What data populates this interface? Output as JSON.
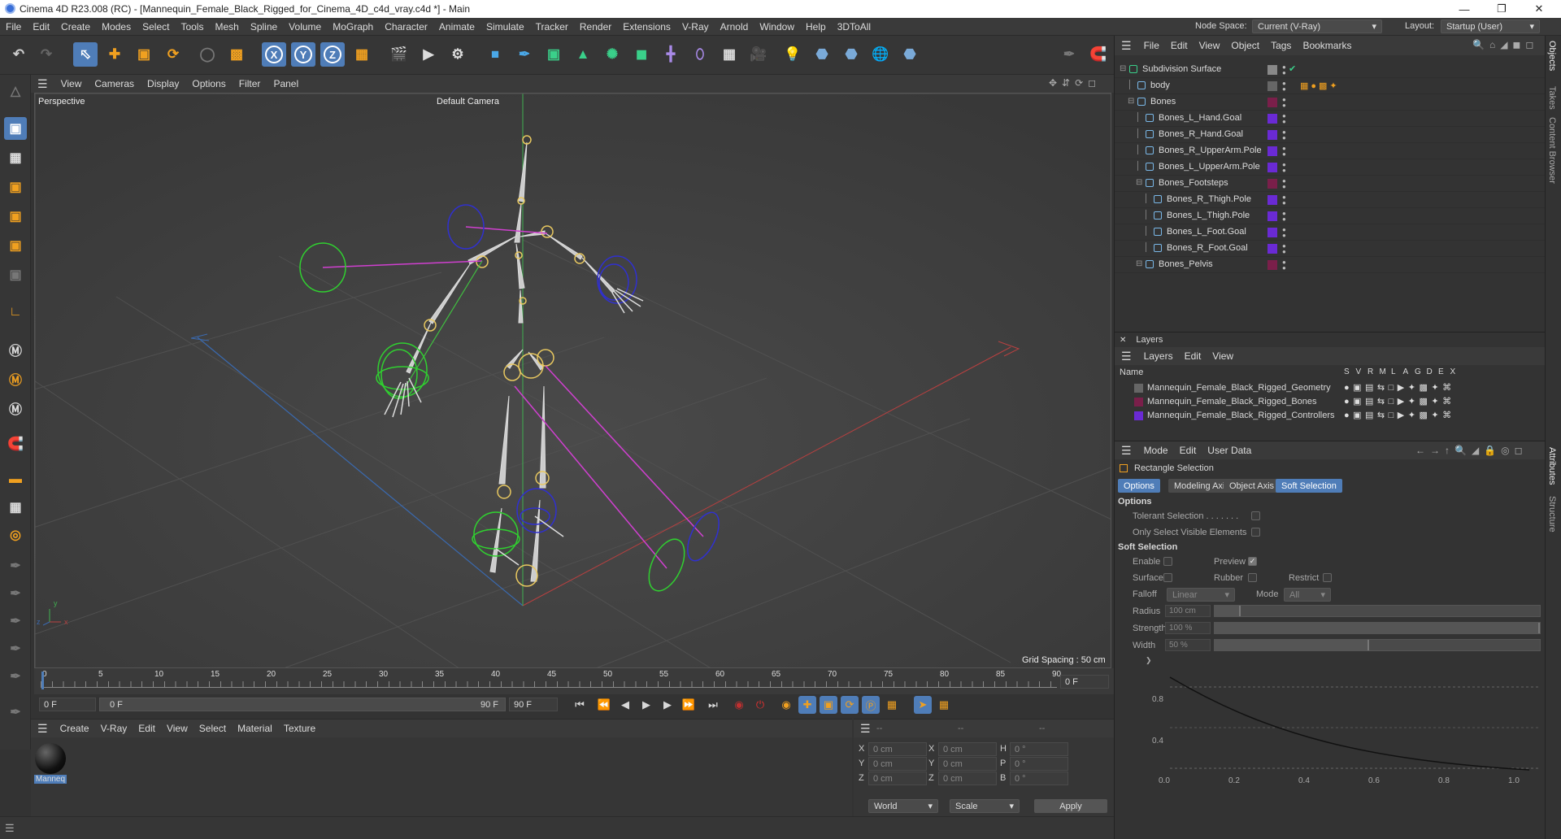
{
  "window": {
    "title": "Cinema 4D R23.008 (RC) - [Mannequin_Female_Black_Rigged_for_Cinema_4D_c4d_vray.c4d *] - Main",
    "minimize": "—",
    "maximize": "❐",
    "close": "✕"
  },
  "menubar": {
    "items": [
      "File",
      "Edit",
      "Create",
      "Modes",
      "Select",
      "Tools",
      "Mesh",
      "Spline",
      "Volume",
      "MoGraph",
      "Character",
      "Animate",
      "Simulate",
      "Tracker",
      "Render",
      "Extensions",
      "V-Ray",
      "Arnold",
      "Window",
      "Help",
      "3DToAll"
    ],
    "node_space_label": "Node Space:",
    "node_space_value": "Current (V-Ray)",
    "layout_label": "Layout:",
    "layout_value": "Startup (User)"
  },
  "toolbar": {
    "x": "X",
    "y": "Y",
    "z": "Z"
  },
  "viewport": {
    "menu": [
      "View",
      "Cameras",
      "Display",
      "Options",
      "Filter",
      "Panel"
    ],
    "label": "Perspective",
    "camera": "Default Camera",
    "grid_spacing": "Grid Spacing : 50 cm"
  },
  "timeline": {
    "ticks": [
      "0",
      "5",
      "10",
      "15",
      "20",
      "25",
      "30",
      "35",
      "40",
      "45",
      "50",
      "55",
      "60",
      "65",
      "70",
      "75",
      "80",
      "85",
      "90"
    ],
    "current_frame": "0 F"
  },
  "transport": {
    "start": "0 F",
    "range_start": "0 F",
    "range_end": "90 F",
    "end": "90 F"
  },
  "materials": {
    "menu": [
      "Create",
      "V-Ray",
      "Edit",
      "View",
      "Select",
      "Material",
      "Texture"
    ],
    "items": [
      {
        "name": "Manneq"
      }
    ]
  },
  "coordinates": {
    "header": [
      "--",
      "--",
      "--"
    ],
    "rows": [
      {
        "a": "X",
        "av": "0 cm",
        "b": "X",
        "bv": "0 cm",
        "c": "H",
        "cv": "0 °"
      },
      {
        "a": "Y",
        "av": "0 cm",
        "b": "Y",
        "bv": "0 cm",
        "c": "P",
        "cv": "0 °"
      },
      {
        "a": "Z",
        "av": "0 cm",
        "b": "Z",
        "bv": "0 cm",
        "c": "B",
        "cv": "0 °"
      }
    ],
    "space": "World",
    "mode": "Scale",
    "apply": "Apply"
  },
  "objects": {
    "menu": [
      "File",
      "Edit",
      "View",
      "Object",
      "Tags",
      "Bookmarks"
    ],
    "rows": [
      {
        "name": "Subdivision Surface",
        "indent": 0,
        "color": "#888888"
      },
      {
        "name": "body",
        "indent": 1,
        "color": "#666666"
      },
      {
        "name": "Bones",
        "indent": 1,
        "color": "#7a1f4a"
      },
      {
        "name": "Bones_L_Hand.Goal",
        "indent": 2,
        "color": "#6a2ad4"
      },
      {
        "name": "Bones_R_Hand.Goal",
        "indent": 2,
        "color": "#6a2ad4"
      },
      {
        "name": "Bones_R_UpperArm.Pole",
        "indent": 2,
        "color": "#6a2ad4"
      },
      {
        "name": "Bones_L_UpperArm.Pole",
        "indent": 2,
        "color": "#6a2ad4"
      },
      {
        "name": "Bones_Footsteps",
        "indent": 2,
        "color": "#7a1f4a"
      },
      {
        "name": "Bones_R_Thigh.Pole",
        "indent": 3,
        "color": "#6a2ad4"
      },
      {
        "name": "Bones_L_Thigh.Pole",
        "indent": 3,
        "color": "#6a2ad4"
      },
      {
        "name": "Bones_L_Foot.Goal",
        "indent": 3,
        "color": "#6a2ad4"
      },
      {
        "name": "Bones_R_Foot.Goal",
        "indent": 3,
        "color": "#6a2ad4"
      },
      {
        "name": "Bones_Pelvis",
        "indent": 2,
        "color": "#7a1f4a"
      }
    ]
  },
  "layers": {
    "title": "Layers",
    "menu": [
      "Layers",
      "Edit",
      "View"
    ],
    "col_name": "Name",
    "cols": [
      "S",
      "V",
      "R",
      "M",
      "L",
      "A",
      "G",
      "D",
      "E",
      "X"
    ],
    "rows": [
      {
        "name": "Mannequin_Female_Black_Rigged_Geometry",
        "color": "#666666"
      },
      {
        "name": "Mannequin_Female_Black_Rigged_Bones",
        "color": "#7a1f4a"
      },
      {
        "name": "Mannequin_Female_Black_Rigged_Controllers",
        "color": "#6a2ad4"
      }
    ]
  },
  "attributes": {
    "menu": [
      "Mode",
      "Edit",
      "User Data"
    ],
    "tool_name": "Rectangle Selection",
    "tabs": [
      "Options",
      "Modeling Axis",
      "Object Axis",
      "Soft Selection"
    ],
    "options_header": "Options",
    "tolerant": "Tolerant Selection . . . . . . .",
    "only_visible": "Only Select Visible Elements",
    "soft_header": "Soft Selection",
    "enable": "Enable",
    "preview": "Preview",
    "surface": "Surface",
    "rubber": "Rubber",
    "restrict": "Restrict",
    "falloff_label": "Falloff",
    "falloff_value": "Linear",
    "mode_label": "Mode",
    "mode_value": "All",
    "radius_label": "Radius",
    "radius_value": "100 cm",
    "strength_label": "Strength",
    "strength_value": "100 %",
    "width_label": "Width",
    "width_value": "50 %",
    "graph_y": [
      "0.8",
      "0.4"
    ],
    "graph_x": [
      "0.0",
      "0.2",
      "0.4",
      "0.6",
      "0.8",
      "1.0"
    ]
  },
  "side_tabs": {
    "right_top": [
      "Objects",
      "Takes",
      "Content Browser"
    ],
    "right_bottom": [
      "Attributes",
      "Structure"
    ]
  }
}
